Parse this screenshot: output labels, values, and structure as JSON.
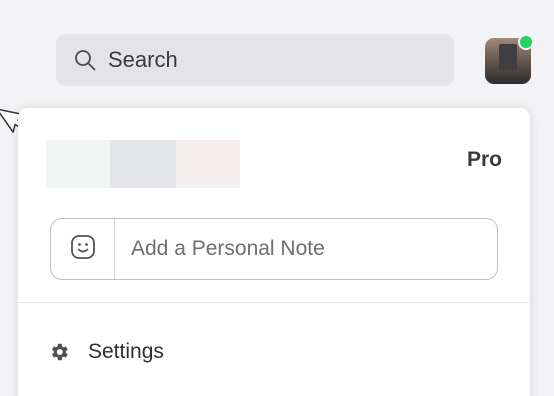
{
  "header": {
    "search": {
      "label": "Search",
      "icon": "search-icon"
    },
    "avatar": {
      "status": "online",
      "status_color": "#23d160"
    }
  },
  "profile_menu": {
    "plan": "Pro",
    "personal_note": {
      "placeholder": "Add a Personal Note",
      "icon": "smiley-icon"
    },
    "items": [
      {
        "label": "Settings",
        "icon": "gear-icon"
      }
    ]
  },
  "colors": {
    "background": "#f3f3f5",
    "search_bg": "#e4e4e8",
    "panel_bg": "#ffffff",
    "text": "#3a3a3e"
  }
}
